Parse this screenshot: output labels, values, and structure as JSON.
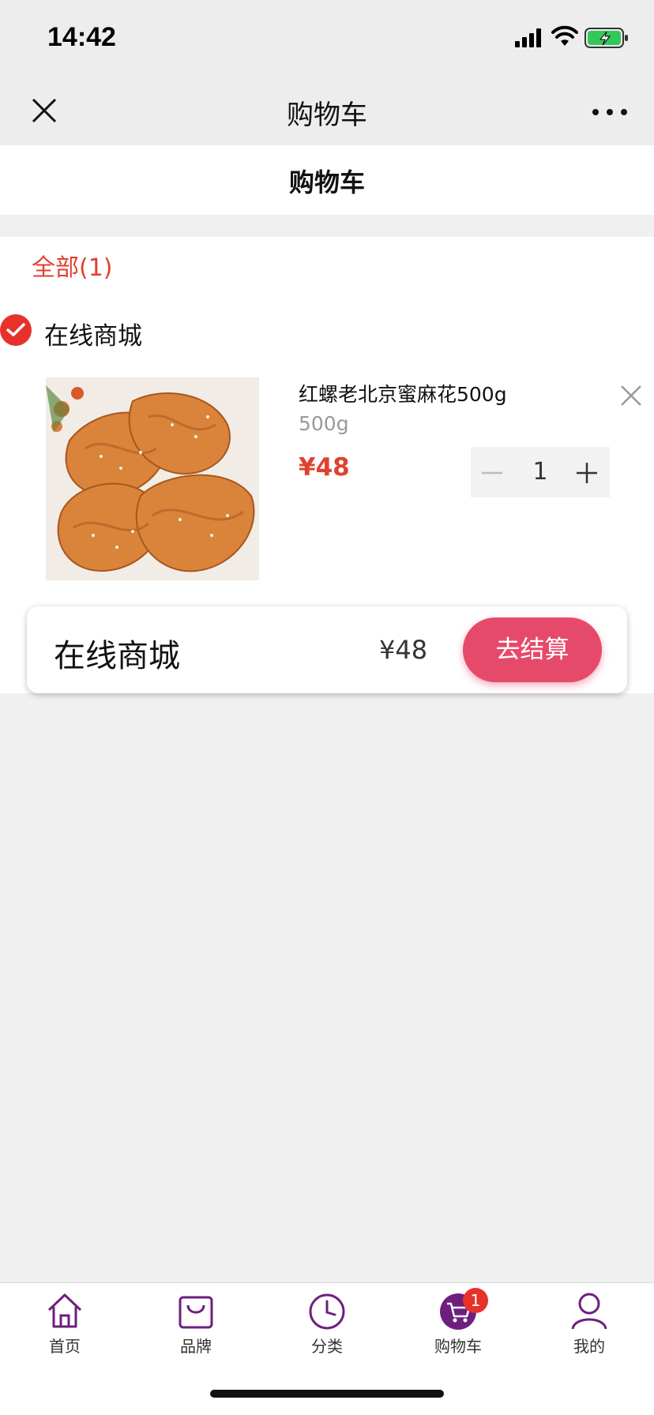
{
  "status_bar": {
    "time": "14:42"
  },
  "nav": {
    "title": "购物车",
    "close_icon": "close-icon",
    "more_icon": "more-icon"
  },
  "page": {
    "title": "购物车"
  },
  "cart": {
    "filter_tab": "全部(1)",
    "store": {
      "name": "在线商城",
      "checked": true
    },
    "item": {
      "name": "红螺老北京蜜麻花500g",
      "spec": "500g",
      "price": "¥48",
      "quantity": "1"
    }
  },
  "checkout": {
    "store_name": "在线商城",
    "total": "¥48",
    "button_label": "去结算"
  },
  "tab_bar": {
    "items": [
      {
        "label": "首页",
        "icon": "home-icon"
      },
      {
        "label": "品牌",
        "icon": "bag-icon"
      },
      {
        "label": "分类",
        "icon": "clock-icon"
      },
      {
        "label": "购物车",
        "icon": "cart-icon",
        "badge": "1",
        "active": true
      },
      {
        "label": "我的",
        "icon": "user-icon"
      }
    ]
  },
  "colors": {
    "accent_red": "#e0412f",
    "checkout_pink": "#e64a6a",
    "tab_purple": "#6e1f7e"
  }
}
